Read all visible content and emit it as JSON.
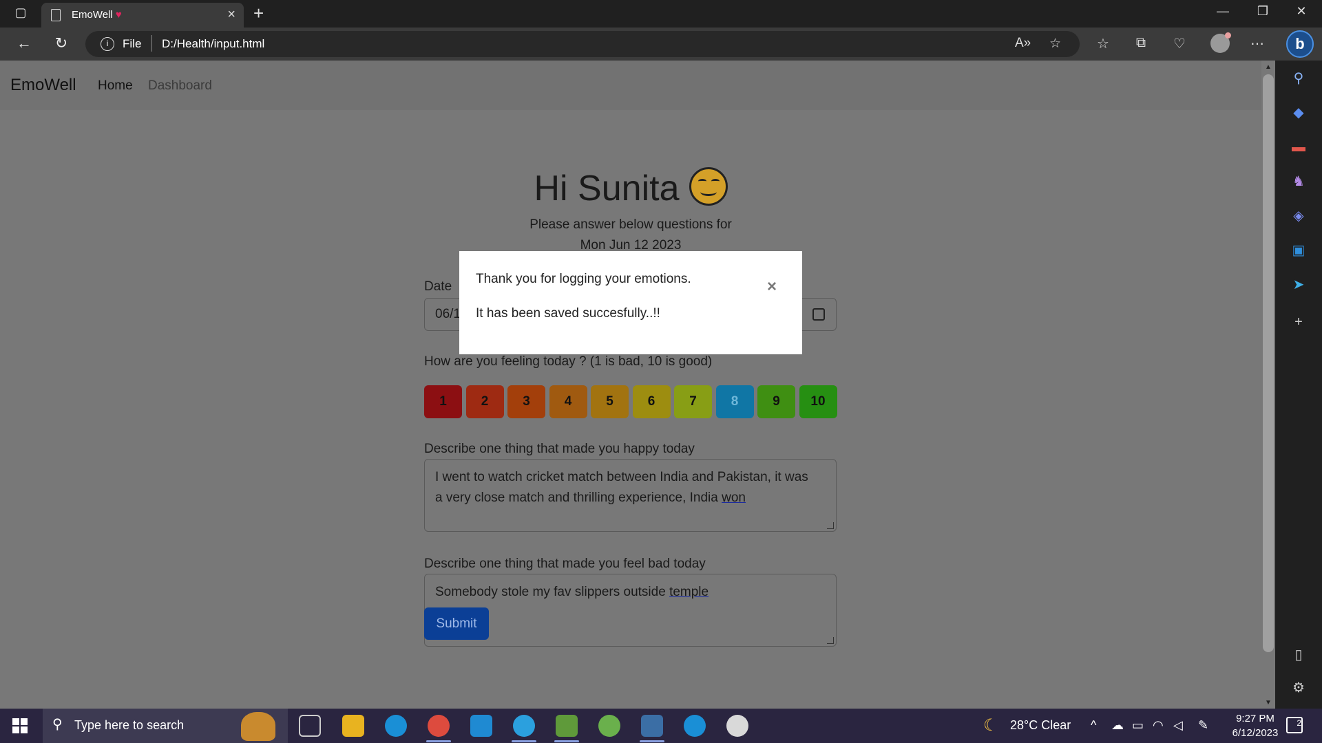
{
  "browser": {
    "tab_title": "EmoWell",
    "tab_heart": "♥",
    "url_scheme": "File",
    "url": "D:/Health/input.html"
  },
  "navbar": {
    "brand": "EmoWell",
    "links": [
      "Home",
      "Dashboard"
    ]
  },
  "page": {
    "greeting": "Hi Sunita",
    "subtitle_line1": "Please answer below questions for",
    "subtitle_line2": "Mon Jun 12 2023",
    "date_label": "Date",
    "date_value": "06/1",
    "mood_question": "How are you feeling today ? (1 is bad, 10 is good)",
    "mood_scale": [
      {
        "label": "1",
        "color": "#8c0f12"
      },
      {
        "label": "2",
        "color": "#9e2a12"
      },
      {
        "label": "3",
        "color": "#a33f0b"
      },
      {
        "label": "4",
        "color": "#a05a10"
      },
      {
        "label": "5",
        "color": "#a27310"
      },
      {
        "label": "6",
        "color": "#9d8d10"
      },
      {
        "label": "7",
        "color": "#889e15"
      },
      {
        "label": "8",
        "color": "#1076a5",
        "selected": true
      },
      {
        "label": "9",
        "color": "#3f8f12"
      },
      {
        "label": "10",
        "color": "#268f12"
      }
    ],
    "happy_label": "Describe one thing that made you happy today",
    "happy_text_line1": "I went to watch cricket match between India and Pakistan, it was",
    "happy_text_line2_plain": "a very close match and thrilling experience, India ",
    "happy_text_line2_underlined": "won",
    "bad_label": "Describe one thing that made you feel bad today",
    "bad_text_plain": "Somebody stole my fav slippers outside ",
    "bad_text_underlined": "temple",
    "submit_label": "Submit"
  },
  "modal": {
    "message1": "Thank you for logging your emotions.",
    "message2": "It has been saved succesfully..!!",
    "close": "×"
  },
  "taskbar": {
    "search_placeholder": "Type here to search",
    "weather": "28°C  Clear",
    "time": "9:27 PM",
    "date": "6/12/2023",
    "notifications": "2"
  }
}
